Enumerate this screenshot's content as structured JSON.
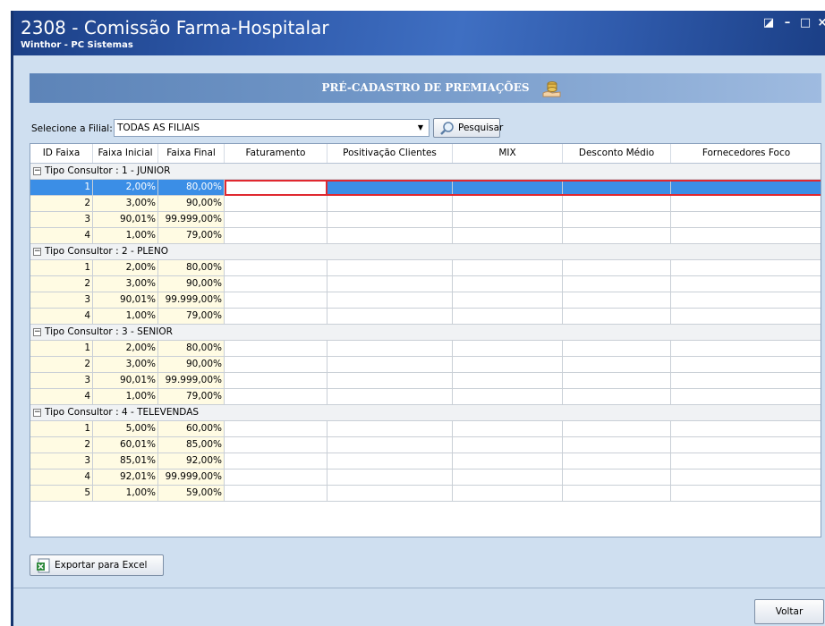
{
  "window": {
    "title": "2308 - Comissão Farma-Hospitalar",
    "subtitle": "Winthor - PC Sistemas",
    "controls": [
      "restore-icon",
      "minimize-icon",
      "maximize-icon",
      "close-icon"
    ]
  },
  "banner": {
    "title": "PRÉ-CADASTRO DE PREMIAÇÕES",
    "icon": "money-hand-icon"
  },
  "filter": {
    "label": "Selecione a Filial:",
    "value": "TODAS AS FILIAIS",
    "search_label": "Pesquisar",
    "search_icon": "magnifier-icon"
  },
  "grid": {
    "columns": [
      "ID Faixa",
      "Faixa Inicial",
      "Faixa Final",
      "Faturamento",
      "Positivação Clientes",
      "MIX",
      "Desconto Médio",
      "Fornecedores Foco"
    ],
    "groups": [
      {
        "label": "Tipo Consultor : 1 - JUNIOR",
        "rows": [
          [
            "1",
            "2,00%",
            "80,00%"
          ],
          [
            "2",
            "3,00%",
            "90,00%"
          ],
          [
            "3",
            "90,01%",
            "99.999,00%"
          ],
          [
            "4",
            "1,00%",
            "79,00%"
          ]
        ]
      },
      {
        "label": "Tipo Consultor : 2 - PLENO",
        "rows": [
          [
            "1",
            "2,00%",
            "80,00%"
          ],
          [
            "2",
            "3,00%",
            "90,00%"
          ],
          [
            "3",
            "90,01%",
            "99.999,00%"
          ],
          [
            "4",
            "1,00%",
            "79,00%"
          ]
        ]
      },
      {
        "label": "Tipo Consultor : 3 - SENIOR",
        "rows": [
          [
            "1",
            "2,00%",
            "80,00%"
          ],
          [
            "2",
            "3,00%",
            "90,00%"
          ],
          [
            "3",
            "90,01%",
            "99.999,00%"
          ],
          [
            "4",
            "1,00%",
            "79,00%"
          ]
        ]
      },
      {
        "label": "Tipo Consultor : 4 - TELEVENDAS",
        "rows": [
          [
            "1",
            "5,00%",
            "60,00%"
          ],
          [
            "2",
            "60,01%",
            "85,00%"
          ],
          [
            "3",
            "85,01%",
            "92,00%"
          ],
          [
            "4",
            "92,01%",
            "99.999,00%"
          ],
          [
            "5",
            "1,00%",
            "59,00%"
          ]
        ]
      }
    ],
    "selection_color": "#3b8ee6",
    "highlight_color": "#e0282f"
  },
  "footer": {
    "export_label": "Exportar para Excel",
    "export_icon": "excel-icon",
    "back_label": "Voltar"
  }
}
